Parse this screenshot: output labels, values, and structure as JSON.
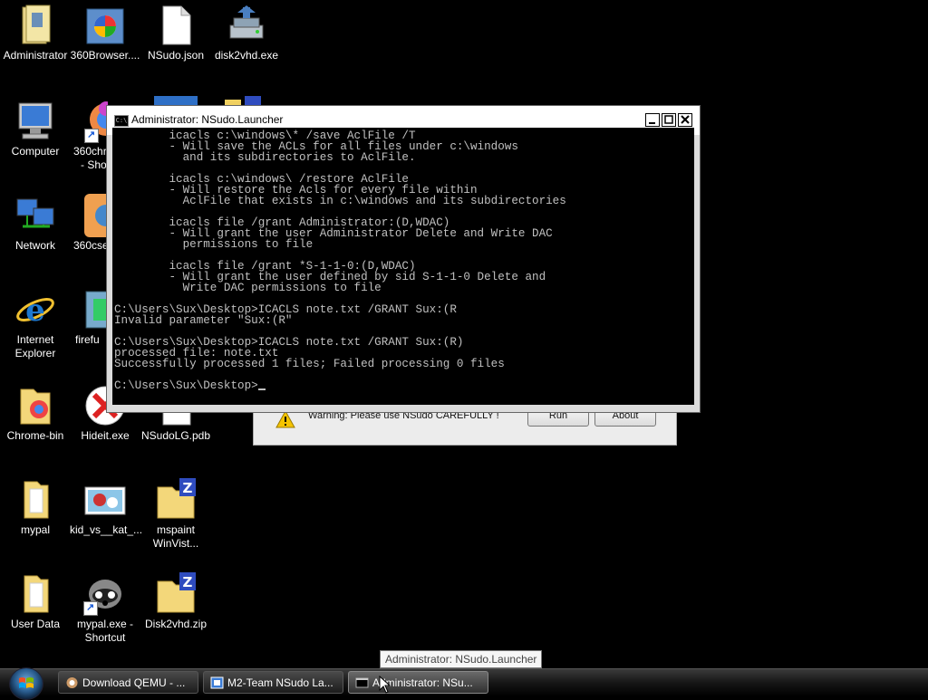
{
  "desktop": {
    "icons": [
      {
        "label": "Administrator"
      },
      {
        "label": "360Browser...."
      },
      {
        "label": "NSudo.json"
      },
      {
        "label": "disk2vhd.exe"
      },
      {
        "label": "Computer"
      },
      {
        "label": "360chr"
      },
      {
        "label": "- Sho"
      },
      {
        "label": "Network"
      },
      {
        "label": "360cse"
      },
      {
        "label": "Internet"
      },
      {
        "label": "Explorer"
      },
      {
        "label": "firefu"
      },
      {
        "label": "Chrome-bin"
      },
      {
        "label": "Hideit.exe"
      },
      {
        "label": "NSudoLG.pdb"
      },
      {
        "label": "mypal"
      },
      {
        "label": "kid_vs__kat_..."
      },
      {
        "label": "mspaint"
      },
      {
        "label": "WinVist..."
      },
      {
        "label": "User Data"
      },
      {
        "label": "mypal.exe -"
      },
      {
        "label": "Shortcut"
      },
      {
        "label": "Disk2vhd.zip"
      }
    ]
  },
  "nsudo_dialog": {
    "warning": "Warning: Please use NSudo CAREFULLY !",
    "run_label": "Run",
    "about_label": "About"
  },
  "console": {
    "title": "Administrator: NSudo.Launcher",
    "icon_text": "C:\\",
    "text": "        icacls c:\\windows\\* /save AclFile /T\n        - Will save the ACLs for all files under c:\\windows\n          and its subdirectories to AclFile.\n\n        icacls c:\\windows\\ /restore AclFile\n        - Will restore the Acls for every file within\n          AclFile that exists in c:\\windows and its subdirectories\n\n        icacls file /grant Administrator:(D,WDAC)\n        - Will grant the user Administrator Delete and Write DAC\n          permissions to file\n\n        icacls file /grant *S-1-1-0:(D,WDAC)\n        - Will grant the user defined by sid S-1-1-0 Delete and\n          Write DAC permissions to file\n\nC:\\Users\\Sux\\Desktop>ICACLS note.txt /GRANT Sux:(R\nInvalid parameter \"Sux:(R\"\n\nC:\\Users\\Sux\\Desktop>ICACLS note.txt /GRANT Sux:(R)\nprocessed file: note.txt\nSuccessfully processed 1 files; Failed processing 0 files\n\nC:\\Users\\Sux\\Desktop>"
  },
  "tooltip": "Administrator: NSudo.Launcher",
  "taskbar": {
    "items": [
      {
        "label": "Download QEMU - ..."
      },
      {
        "label": "M2-Team NSudo La..."
      },
      {
        "label": "Administrator: NSu..."
      }
    ]
  }
}
